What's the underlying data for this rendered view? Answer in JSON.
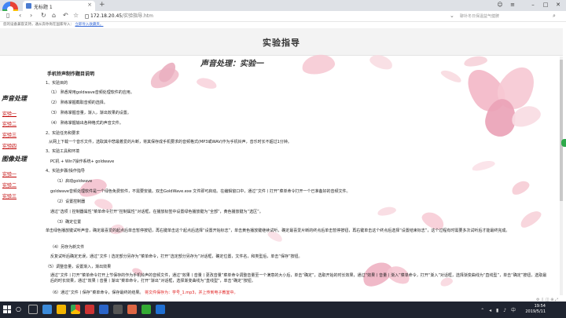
{
  "browser": {
    "tab_title": "无标题 1",
    "tab_close": "×",
    "new_tab": "+",
    "address": "172.18.20.45",
    "address_path": "/实验指导.htm",
    "search_placeholder": "聊补冬日保温益气健脾",
    "info_text": "您的设备兼容支持，通从奔你尚在国家导入：",
    "info_link": "立即导入收藏夹。"
  },
  "page": {
    "header_title": "实验指导",
    "content_title": "声音处理：实验一",
    "sidebar": {
      "section1": "声音处理",
      "section1_items": [
        "实验一",
        "实验二",
        "实验三",
        "实验四"
      ],
      "section2": "图像处理",
      "section2_items": [
        "实验一",
        "实验二",
        "实验三"
      ]
    },
    "lines": [
      "手机铃声制作题目说明",
      "1、实验目的",
      "（1）   熟悉常用goldwave音频处理软件的应用。",
      "（2）   熟练掌握截取音频的选择。",
      "（3）   熟练掌握音量，渐入，渐出效果的设置。",
      "（4）   熟练掌握输出各种格式的声音文件。",
      "2、实验任务和要求",
      "从网上下载一个音乐文件，选取其中悲最着爱的片断，将其保存成手机要求的音频格式(MP3或WAV)作为手机铃声，音乐时长不超过1分钟。",
      "3、实验工具和环境",
      "PC机 + Win7操作系统+ goldwave",
      "4、实验步骤/操作指导",
      "（1）启动goldwave",
      "goldwave音频处理软件是一个绿色免费软件，不需要安装。双击GoldWave.exe 文件即可启动。在编辑窗口中，通过“文件丨打开”菜单命令打开一个已准备好的音频文件。",
      "（2）设置控制器",
      "通过“选项丨控制器属性”菜单命令打开“控制属性”对话框，在播放标签中设置绿色播放键为“全部”，黄色播放键为“选区”。",
      "（3）确定位置",
      "单击绿色播放键试听声音，确定最喜爱的起点后单击暂停按钮，再右键单击这个起点后选择“设置开始标志”，单击黄色播放键继续试听，确定最喜爱片断的终点后单击暂停按钮，再右键单击这个终点后选择“设置结束标志”，这个过程有时需要多次试听后才能最终完成。",
      "（4）另存为新文件",
      "反复试听后确定无误，通过“文件丨选定部分另存为”菜单命令，打开“选定部分另存为”对话框，确定位置，文件名，和类型后，单击“保存”按钮。",
      "（5）调整音量，设置渐入，渐出效果",
      "通过“文件丨打开”菜单命令打开上节保存的作为手机铃声的音频文件，通过“效果丨音量丨更改音量”菜单命令调整音量至一个满意的大小后，单击“确定”，选取开始的时长效果，通过“效果丨音量丨渐入”菜单命令，打开“渐入”对话框，选择渐变曲线为“直线型”，单击“确定”按钮，选取最后的时长效果，通过“效果丨音量丨渐出”菜单命令，打开“渐出”对话框，选择渐变曲线为“直线型”，单击“确定”按钮。",
      "（6）通过“文件丨保存”菜单命令，保存最终的结果。",
      "将文件保存为：学号_1.mp3，并上传到电子教室中。"
    ]
  },
  "taskbar": {
    "time": "19:54",
    "date": "2019/5/11",
    "search_icon": "search-icon"
  },
  "colors": {
    "link_red": "#c00000",
    "highlight_red": "#e02020",
    "petal_pink": "#f4c6d0",
    "taskbar_bg": "#1f2430"
  }
}
